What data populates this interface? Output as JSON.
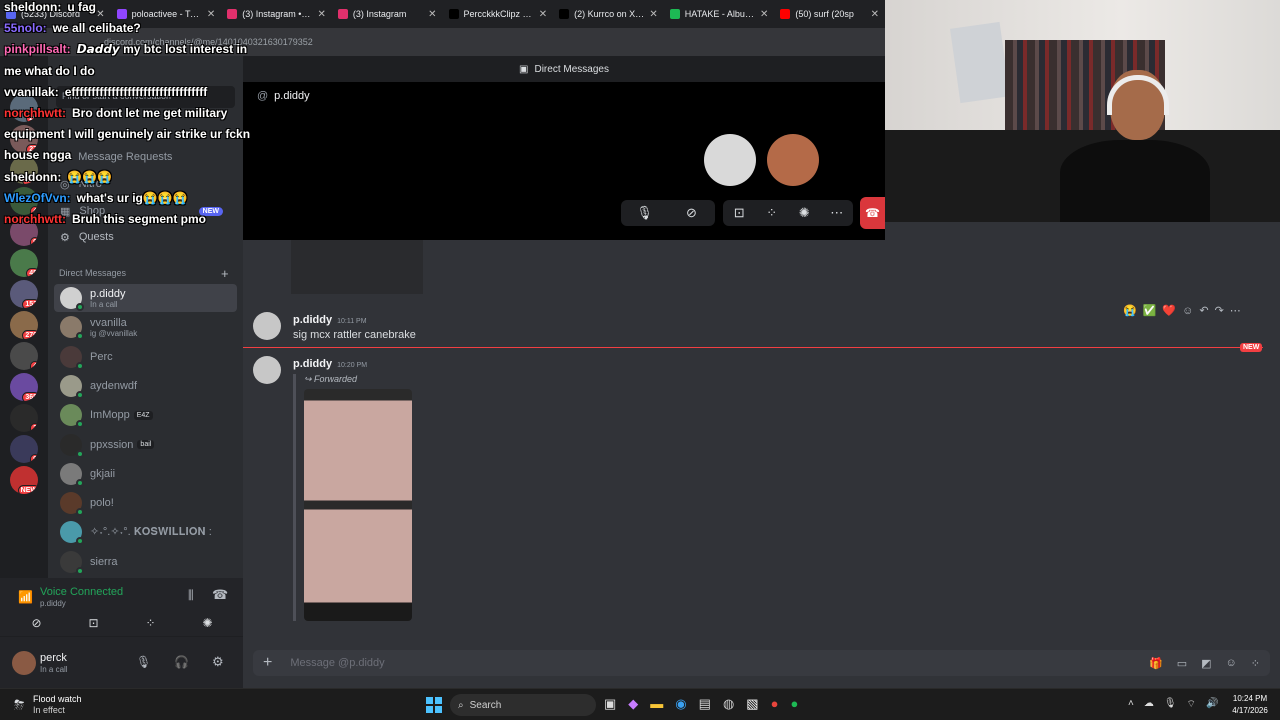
{
  "browser": {
    "tabs": [
      {
        "label": "(5233) Discord",
        "color": "#5865f2"
      },
      {
        "label": "poloactivee - Twitch",
        "color": "#9146ff"
      },
      {
        "label": "(3) Instagram • Me",
        "color": "#e1306c"
      },
      {
        "label": "(3) Instagram",
        "color": "#e1306c"
      },
      {
        "label": "PercckkkClipz (@p",
        "color": "#000000"
      },
      {
        "label": "(2) Kurrco on X: \"W",
        "color": "#000000"
      },
      {
        "label": "HATAKE - Album b",
        "color": "#1db954"
      },
      {
        "label": "(50) surf (20sp",
        "color": "#ff0000"
      }
    ],
    "url": "discord.com/channels/@me/1401040321630179352"
  },
  "discord": {
    "title": "Direct Messages",
    "find_placeholder": "Find or start a conversation",
    "sidebar_items": [
      {
        "label": "Message Requests",
        "icon": "envelope-icon"
      },
      {
        "label": "Nitro",
        "icon": "nitro-icon"
      },
      {
        "label": "Shop",
        "icon": "shop-icon",
        "badge": "NEW"
      },
      {
        "label": "Quests",
        "icon": "quests-icon"
      }
    ],
    "dm_header": "Direct Messages",
    "dm_add": "+",
    "dms": [
      {
        "name": "p.diddy",
        "sub": "In a call"
      },
      {
        "name": "vvanilla",
        "sub": "ig @vvanillak"
      },
      {
        "name": "Perc",
        "sub": ""
      },
      {
        "name": "aydenwdf",
        "sub": ""
      },
      {
        "name": "ImMopp",
        "sub": "",
        "tag": "E4Z"
      },
      {
        "name": "ppxssion",
        "sub": "",
        "tag": "bail"
      },
      {
        "name": "gkjaii",
        "sub": ""
      },
      {
        "name": "polo!",
        "sub": ""
      },
      {
        "name": "✧˖°.✧˖°. 𝐊𝐎𝐒𝐖𝐈𝐋𝐋𝐈𝐎𝐍 :",
        "sub": ""
      },
      {
        "name": "sierra",
        "sub": ""
      }
    ],
    "server_badges": [
      "20",
      "27",
      "247",
      "4",
      "9",
      "45",
      "153",
      "270",
      "4",
      "365",
      "3",
      "9",
      "NEW"
    ],
    "voice": {
      "status": "Voice Connected",
      "channel": "p.diddy"
    },
    "user": {
      "name": "perck",
      "status": "In a call"
    },
    "call": {
      "header_name": "p.diddy"
    },
    "messages": [
      {
        "author": "p.diddy",
        "time": "10:11 PM",
        "text": "sig mcx rattler canebrake"
      },
      {
        "author": "p.diddy",
        "time": "10:20 PM",
        "forwarded": "Forwarded",
        "text": ""
      }
    ],
    "new_divider": "NEW",
    "composer_placeholder": "Message @p.diddy",
    "reactions": [
      "😭",
      "✅",
      "❤️"
    ]
  },
  "stream_chat": [
    {
      "user": "sheldonn:",
      "text": "u fag",
      "color": "#ffffff"
    },
    {
      "user": "55nolo:",
      "text": "we all celibate?",
      "color": "#8a6bff"
    },
    {
      "user": "pinkpillsalt:",
      "text": "𝘿𝙖𝙙𝙙𝙮 my btc lost interest in",
      "color": "#ff69b4"
    },
    {
      "user": "",
      "text": "me what do I do",
      "color": "#ffffff"
    },
    {
      "user": "vvanillak:",
      "text": "effffffffffffffffffffffffffffffffff",
      "color": "#ffffff"
    },
    {
      "user": "norchhwtt:",
      "text": "Bro dont let me get military",
      "color": "#ff3333"
    },
    {
      "user": "",
      "text": "equipment I will genuinely air strike ur fckn",
      "color": "#ffffff"
    },
    {
      "user": "",
      "text": "house ngga",
      "color": "#ffffff"
    },
    {
      "user": "sheldonn:",
      "text": "😭😭😭",
      "color": "#ffffff"
    },
    {
      "user": "WlezOfVvn:",
      "text": "what's ur ig😭😭😭",
      "color": "#2d9cff"
    },
    {
      "user": "norchhwtt:",
      "text": "Bruh this segment pmo",
      "color": "#ff3333"
    }
  ],
  "taskbar": {
    "weather_title": "Flood watch",
    "weather_sub": "In effect",
    "search": "Search",
    "time": "10:24 PM",
    "date": "4/17/2026"
  }
}
